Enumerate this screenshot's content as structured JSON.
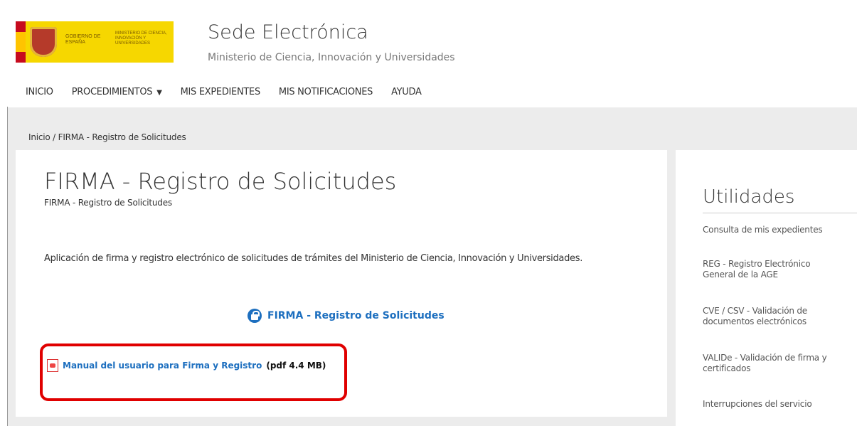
{
  "header": {
    "logo": {
      "gobierno_text": "GOBIERNO DE ESPAÑA",
      "ministerio_text": "MINISTERIO DE CIENCIA, INNOVACIÓN Y UNIVERSIDADES"
    },
    "title": "Sede Electrónica",
    "subtitle": "Ministerio de Ciencia, Innovación y Universidades"
  },
  "nav": {
    "items": [
      "INICIO",
      "PROCEDIMIENTOS",
      "MIS EXPEDIENTES",
      "MIS NOTIFICACIONES",
      "AYUDA"
    ],
    "caret": "▼"
  },
  "breadcrumb": "Inicio / FIRMA - Registro de Solicitudes",
  "main": {
    "title": "FIRMA - Registro de Solicitudes",
    "subtitle": "FIRMA - Registro de Solicitudes",
    "description": "Aplicación de firma y registro electrónico de solicitudes de trámites del Ministerio de Ciencia, Innovación y Universidades.",
    "firma_link": "FIRMA - Registro de Solicitudes",
    "firma_icon": "lock-icon",
    "manual_link": "Manual del usuario para Firma y Registro",
    "manual_size": "(pdf 4.4 MB)",
    "manual_icon": "pdf-icon",
    "highlight_color": "#e00000"
  },
  "sidebar": {
    "title": "Utilidades",
    "items": [
      "Consulta de mis expedientes",
      "REG - Registro Electrónico General de la AGE",
      "CVE / CSV - Validación de documentos electrónicos",
      "VALIDe - Validación de firma y certificados",
      "Interrupciones del servicio"
    ]
  },
  "colors": {
    "link": "#1d6fbf",
    "background": "#ececec",
    "logo_yellow": "#f6d700"
  }
}
